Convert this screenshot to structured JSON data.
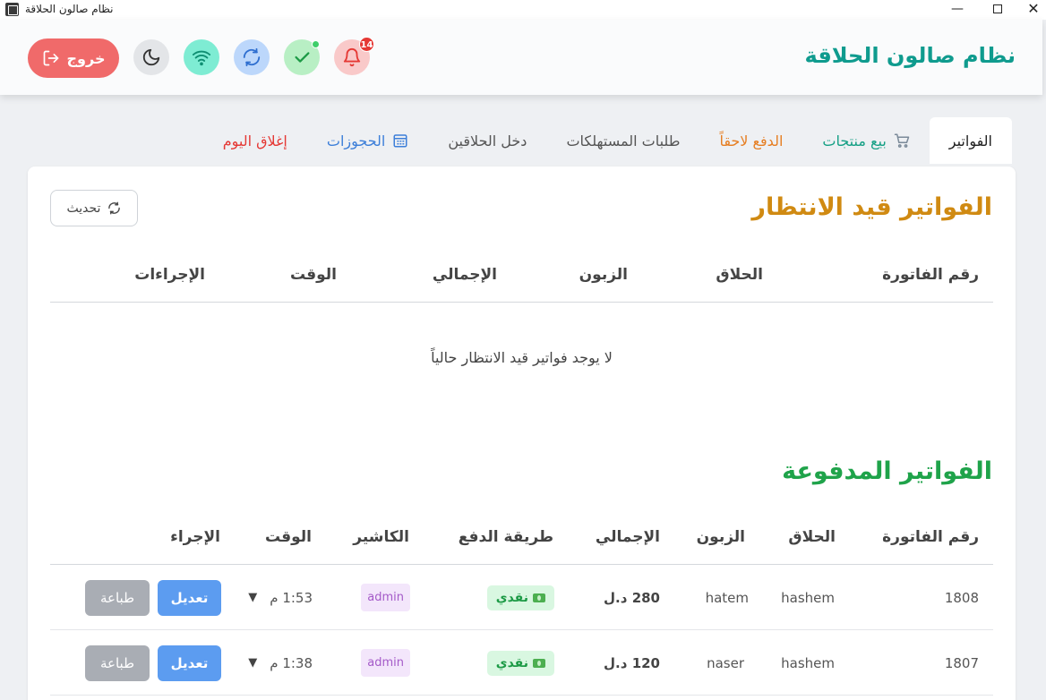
{
  "window": {
    "title": "نظام صالون الحلاقة",
    "minimize": "—",
    "close": "✕"
  },
  "header": {
    "brand": "نظام صالون الحلاقة",
    "notification_count": "14",
    "logout_label": "خروج"
  },
  "tabs": [
    {
      "label": "الفواتير",
      "icon": ""
    },
    {
      "label": "بيع منتجات",
      "icon": "cart-icon"
    },
    {
      "label": "الدفع لاحقاً",
      "icon": ""
    },
    {
      "label": "طلبات المستهلكات",
      "icon": ""
    },
    {
      "label": "دخل الحلاقين",
      "icon": ""
    },
    {
      "label": "الحجوزات",
      "icon": "calendar-icon"
    },
    {
      "label": "إغلاق اليوم",
      "icon": ""
    }
  ],
  "pending": {
    "title": "الفواتير قيد الانتظار",
    "refresh_label": "تحديث",
    "columns": [
      "رقم الفاتورة",
      "الحلاق",
      "الزبون",
      "الإجمالي",
      "الوقت",
      "الإجراءات"
    ],
    "empty_message": "لا يوجد فواتير قيد الانتظار حالياً"
  },
  "paid": {
    "title": "الفواتير المدفوعة",
    "columns": [
      "رقم الفاتورة",
      "الحلاق",
      "الزبون",
      "الإجمالي",
      "طريقة الدفع",
      "الكاشير",
      "الوقت",
      "الإجراء"
    ],
    "edit_label": "تعديل",
    "print_label": "طباعة",
    "rows": [
      {
        "invoice": "1808",
        "barber": "hashem",
        "customer": "hatem",
        "total": "280 د.ل",
        "payment": "نقدي",
        "cashier": "admin",
        "time": "1:53 م"
      },
      {
        "invoice": "1807",
        "barber": "hashem",
        "customer": "naser",
        "total": "120 د.ل",
        "payment": "نقدي",
        "cashier": "admin",
        "time": "1:38 م"
      }
    ]
  },
  "colors": {
    "brand": "#0f9b8e",
    "pending_title": "#d08a12",
    "paid_title": "#1fa34a",
    "logout": "#f06a6a",
    "edit": "#5c9cf0",
    "print": "#a9adb4"
  }
}
